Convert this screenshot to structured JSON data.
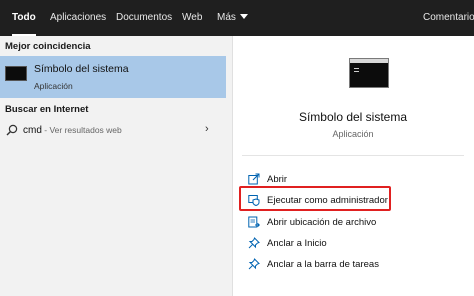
{
  "tabs": [
    {
      "label": "Todo",
      "active": true
    },
    {
      "label": "Aplicaciones"
    },
    {
      "label": "Documentos"
    },
    {
      "label": "Web"
    },
    {
      "label": "Más"
    }
  ],
  "feedback_label": "Comentarios",
  "left": {
    "best_match_heading": "Mejor coincidencia",
    "best_match": {
      "title": "Símbolo del sistema",
      "subtitle": "Aplicación",
      "icon": "command-prompt-icon"
    },
    "web_heading": "Buscar en Internet",
    "web_query": "cmd",
    "web_hint": " - Ver resultados web"
  },
  "detail": {
    "title": "Símbolo del sistema",
    "subtitle": "Aplicación",
    "icon": "command-prompt-icon"
  },
  "actions": [
    {
      "label": "Abrir",
      "icon": "open-icon"
    },
    {
      "label": "Ejecutar como administrador",
      "icon": "shield-admin-icon"
    },
    {
      "label": "Abrir ubicación de archivo",
      "icon": "folder-icon"
    },
    {
      "label": "Anclar a Inicio",
      "icon": "pin-icon"
    },
    {
      "label": "Anclar a la barra de tareas",
      "icon": "pin-icon"
    }
  ],
  "colors": {
    "accent": "#0063b1",
    "selection": "#a8c8e8",
    "highlight_border": "#e02020",
    "top_bar": "#1f1f1f"
  }
}
